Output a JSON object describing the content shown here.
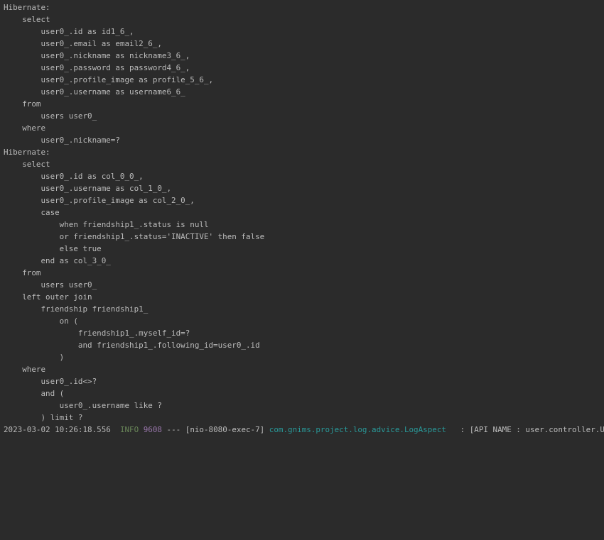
{
  "lines": [
    "Hibernate: ",
    "    select",
    "        user0_.id as id1_6_,",
    "        user0_.email as email2_6_,",
    "        user0_.nickname as nickname3_6_,",
    "        user0_.password as password4_6_,",
    "        user0_.profile_image as profile_5_6_,",
    "        user0_.username as username6_6_ ",
    "    from",
    "        users user0_ ",
    "    where",
    "        user0_.nickname=?",
    "Hibernate: ",
    "    select",
    "        user0_.id as col_0_0_,",
    "        user0_.username as col_1_0_,",
    "        user0_.profile_image as col_2_0_,",
    "        case ",
    "            when friendship1_.status is null ",
    "            or friendship1_.status='INACTIVE' then false ",
    "            else true ",
    "        end as col_3_0_ ",
    "    from",
    "        users user0_ ",
    "    left outer join",
    "        friendship friendship1_ ",
    "            on (",
    "                friendship1_.myself_id=? ",
    "                and friendship1_.following_id=user0_.id",
    "            ) ",
    "    where",
    "        user0_.id<>? ",
    "        and (",
    "            user0_.username like ?",
    "        ) limit ?"
  ],
  "log": {
    "timestamp": "2023-03-02 10:26:18.556",
    "level": "INFO",
    "pid": "9608",
    "separator": "---",
    "thread": "[nio-8080-exec-7]",
    "logger": "com.gnims.project.log.advice.LogAspect",
    "message": ": [API NAME : user.controller.UserController"
  },
  "colors": {
    "background": "#2b2b2b",
    "text": "#bbbbbb",
    "level_info": "#6a8759",
    "pid": "#9876aa",
    "logger": "#299999"
  }
}
